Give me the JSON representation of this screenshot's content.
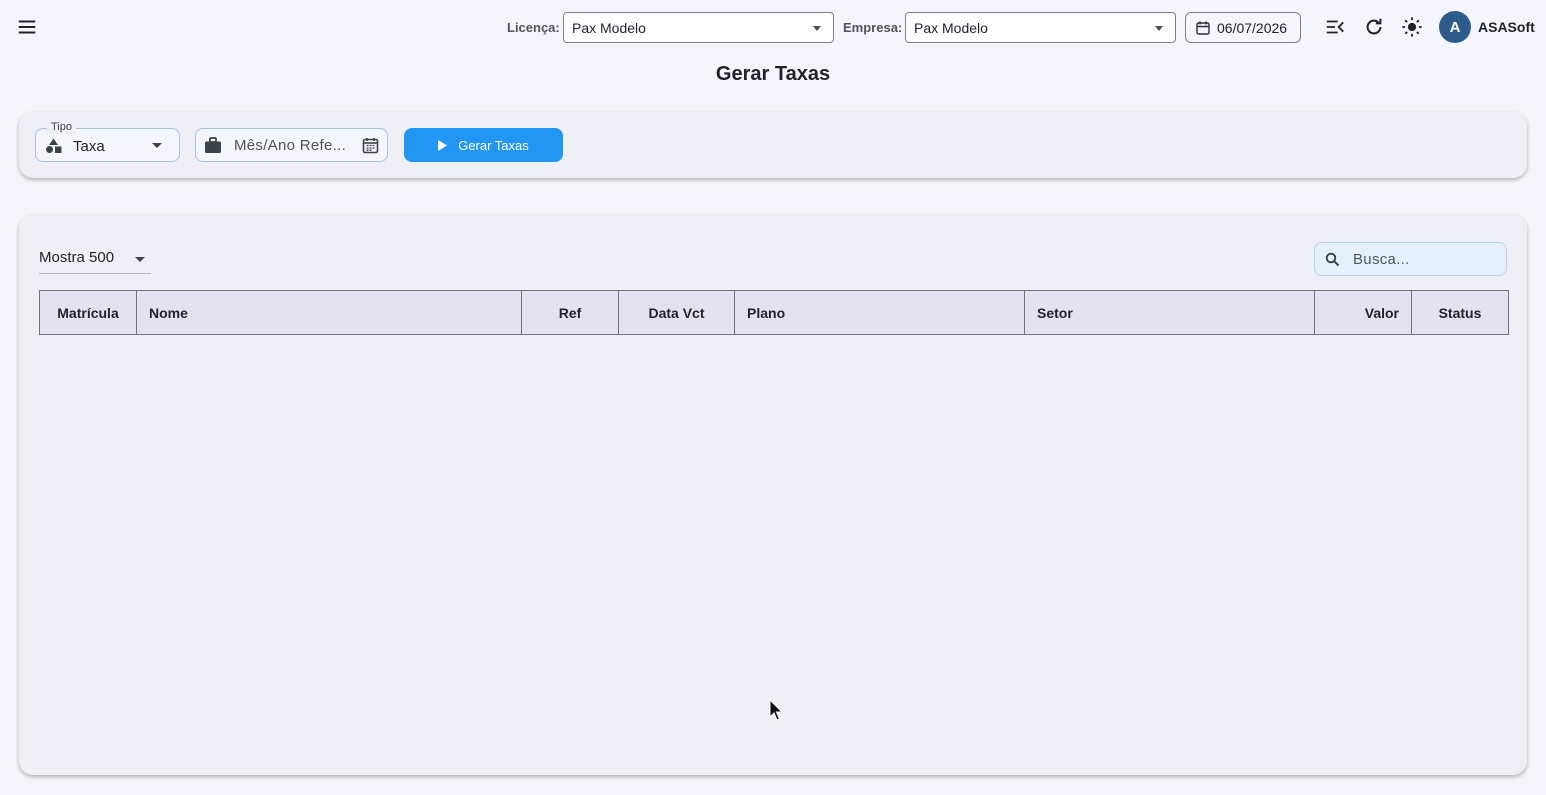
{
  "topbar": {
    "licenca_label": "Licença:",
    "licenca_value": "Pax Modelo",
    "empresa_label": "Empresa:",
    "empresa_value": "Pax Modelo",
    "date": "06/07/2026",
    "user_initial": "A",
    "user_name": "ASASoft"
  },
  "page": {
    "title": "Gerar Taxas"
  },
  "filters": {
    "tipo_label": "Tipo",
    "tipo_value": "Taxa",
    "ref_placeholder": "Mês/Ano Refe...",
    "button_label": "Gerar Taxas"
  },
  "table": {
    "page_size_label": "Mostra 500",
    "search_placeholder": "Busca...",
    "columns": [
      "Matrícula",
      "Nome",
      "Ref",
      "Data Vct",
      "Plano",
      "Setor",
      "Valor",
      "Status"
    ],
    "rows": []
  },
  "colors": {
    "accent": "#2196f3",
    "avatar": "#2f5b8c",
    "background": "#f4f6fb",
    "card": "#eef0f6",
    "table_header": "#e1e4ee"
  }
}
